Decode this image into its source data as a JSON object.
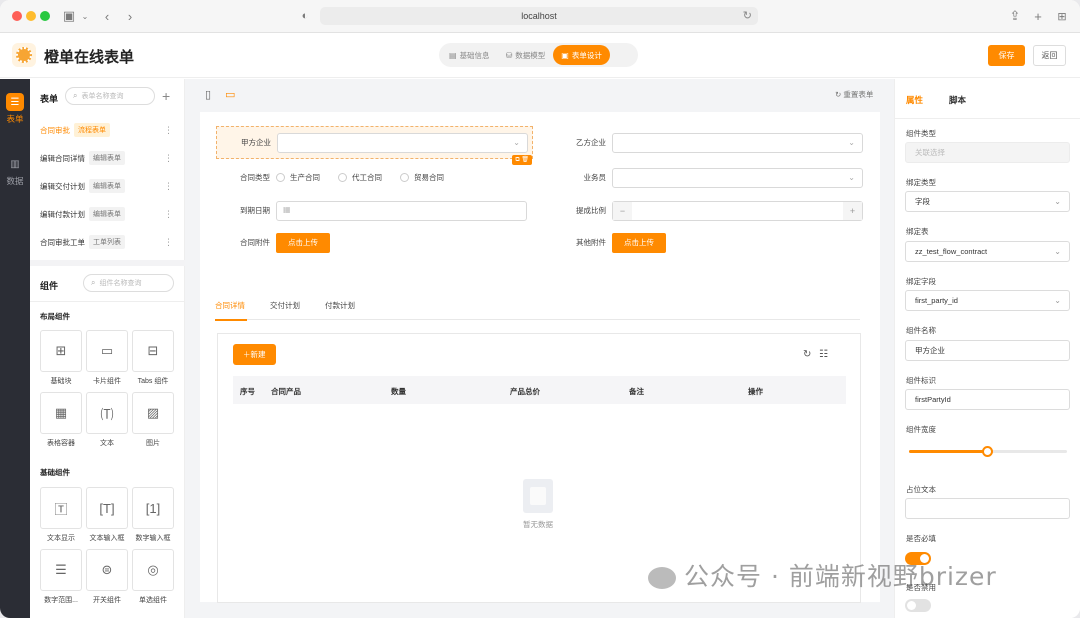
{
  "browser": {
    "url": "localhost"
  },
  "header": {
    "app_title": "橙单在线表单",
    "steps": [
      {
        "label": "基础信息",
        "active": false
      },
      {
        "label": "数据模型",
        "active": false
      },
      {
        "label": "表单设计",
        "active": true
      }
    ],
    "save_label": "保存",
    "back_label": "返回"
  },
  "rail": {
    "items": [
      {
        "label": "表单",
        "active": true,
        "icon": "form-icon"
      },
      {
        "label": "数据",
        "active": false,
        "icon": "chart-icon"
      }
    ]
  },
  "forms_panel": {
    "title": "表单",
    "search_placeholder": "表单名称查询",
    "items": [
      {
        "name": "合同审批",
        "tag": "流程表单",
        "active": true
      },
      {
        "name": "编辑合同详情",
        "tag": "编辑表单",
        "active": false
      },
      {
        "name": "编辑交付计划",
        "tag": "编辑表单",
        "active": false
      },
      {
        "name": "编辑付款计划",
        "tag": "编辑表单",
        "active": false
      },
      {
        "name": "合同审批工单",
        "tag": "工单列表",
        "active": false
      }
    ]
  },
  "components_panel": {
    "title": "组件",
    "search_placeholder": "组件名称查询",
    "layout_title": "布局组件",
    "layout_items": [
      {
        "label": "基础块",
        "icon": "grid-block-icon"
      },
      {
        "label": "卡片组件",
        "icon": "card-icon"
      },
      {
        "label": "Tabs 组件",
        "icon": "tabs-icon"
      },
      {
        "label": "表格容器",
        "icon": "table-container-icon"
      },
      {
        "label": "文本",
        "icon": "text-icon"
      },
      {
        "label": "图片",
        "icon": "image-icon"
      }
    ],
    "basic_title": "基础组件",
    "basic_items": [
      {
        "label": "文本显示",
        "icon": "text-display-icon"
      },
      {
        "label": "文本输入框",
        "icon": "text-input-icon"
      },
      {
        "label": "数字输入框",
        "icon": "number-input-icon"
      },
      {
        "label": "数字范围...",
        "icon": "number-range-icon"
      },
      {
        "label": "开关组件",
        "icon": "switch-icon"
      },
      {
        "label": "单选组件",
        "icon": "radio-icon"
      }
    ]
  },
  "canvas": {
    "reset_label": "重置表单",
    "fields": {
      "party_a": "甲方企业",
      "party_b": "乙方企业",
      "contract_type": "合同类型",
      "salesperson": "业务员",
      "due_date": "到期日期",
      "commission": "提成比例",
      "attachment": "合同附件",
      "other_attachment": "其他附件"
    },
    "contract_type_options": [
      "生产合同",
      "代工合同",
      "贸易合同"
    ],
    "upload_label": "点击上传",
    "tabs": [
      {
        "label": "合同详情",
        "active": true
      },
      {
        "label": "交付计划",
        "active": false
      },
      {
        "label": "付款计划",
        "active": false
      }
    ],
    "new_label": "新建",
    "table_headers": [
      "序号",
      "合同产品",
      "数量",
      "产品总价",
      "备注",
      "操作"
    ],
    "empty_text": "暂无数据"
  },
  "props_panel": {
    "tabs": [
      {
        "label": "属性",
        "active": true
      },
      {
        "label": "脚本",
        "active": false
      }
    ],
    "component_type_label": "组件类型",
    "component_type_value": "关联选择",
    "bind_type_label": "绑定类型",
    "bind_type_value": "字段",
    "bind_table_label": "绑定表",
    "bind_table_value": "zz_test_flow_contract",
    "bind_field_label": "绑定字段",
    "bind_field_value": "first_party_id",
    "component_name_label": "组件名称",
    "component_name_value": "甲方企业",
    "component_id_label": "组件标识",
    "component_id_value": "firstPartyId",
    "component_width_label": "组件宽度",
    "component_width_fraction": 0.5,
    "placeholder_label": "占位文本",
    "placeholder_value": "",
    "required_label": "是否必填",
    "required": true,
    "disabled_label": "是否禁用",
    "disabled": false
  },
  "watermark": {
    "text": "公众号 · 前端新视野brizer"
  },
  "colors": {
    "accent": "#ff8a00",
    "rail_bg": "#2b2d35"
  }
}
